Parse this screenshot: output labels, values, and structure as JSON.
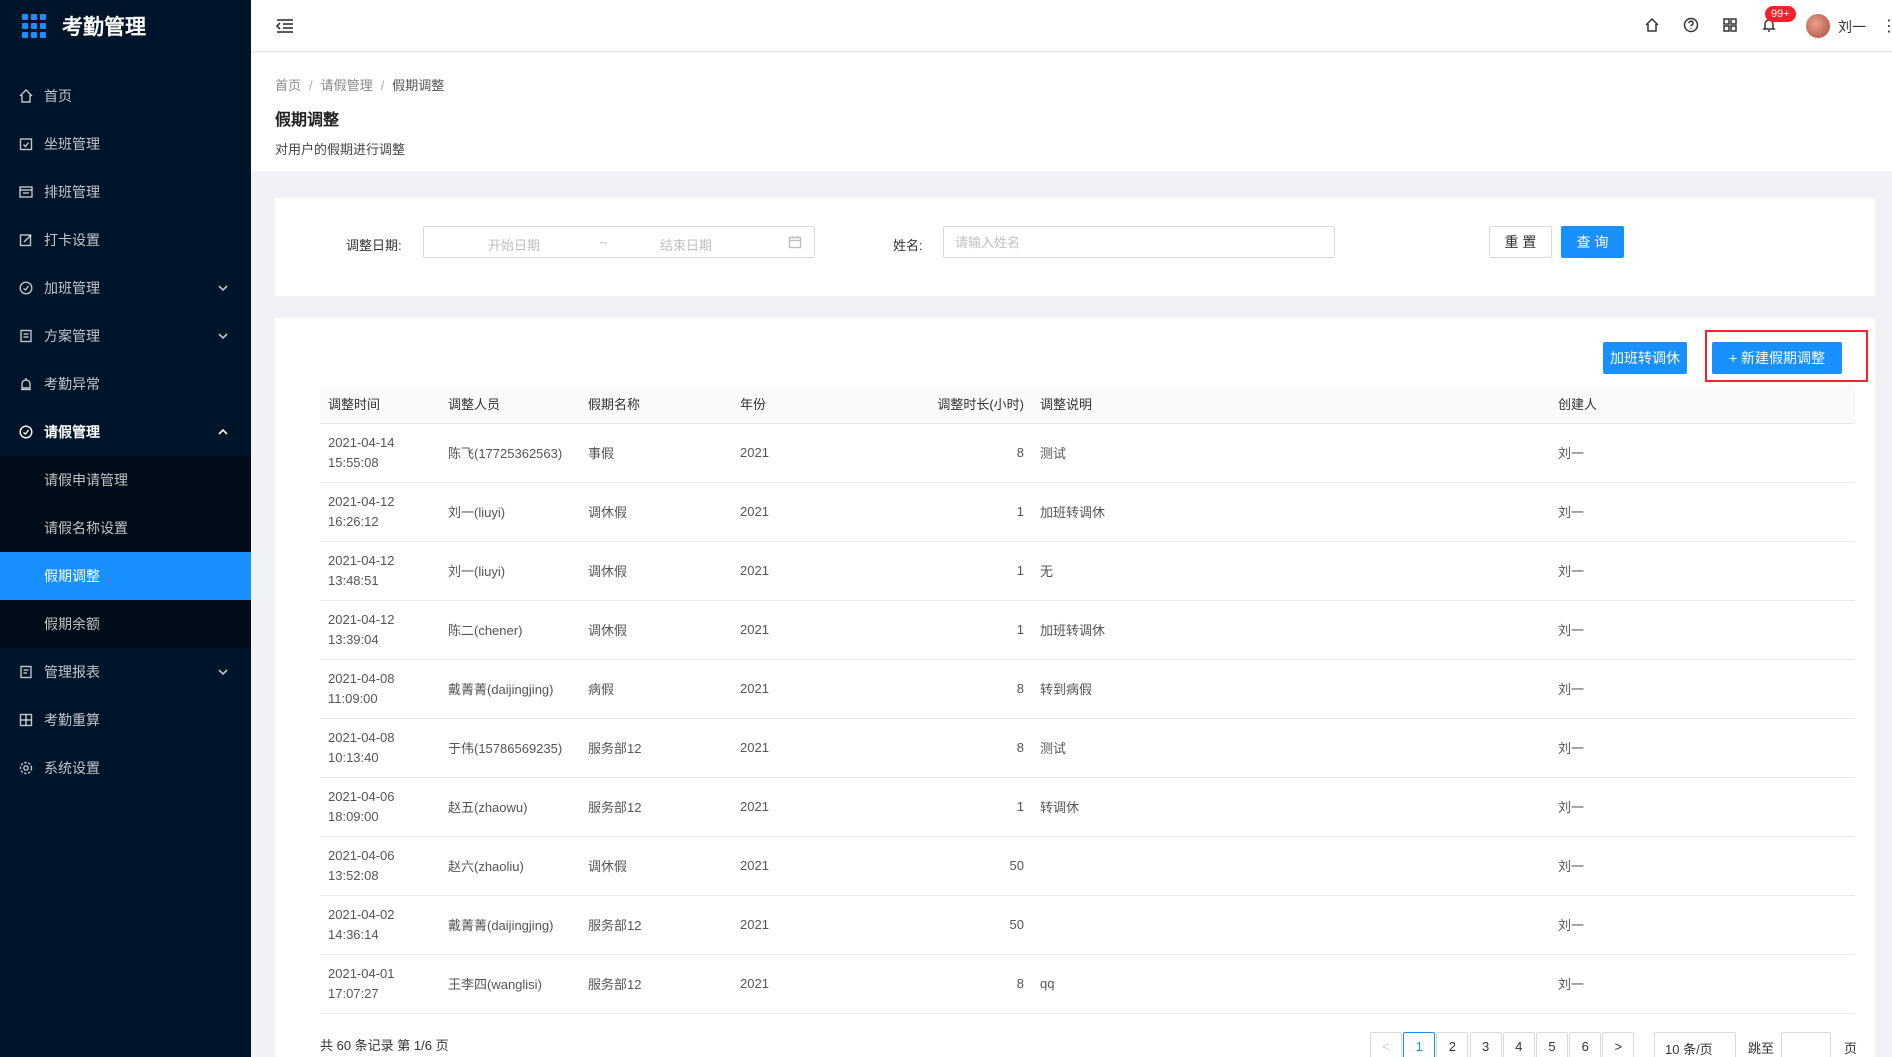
{
  "app": {
    "title": "考勤管理"
  },
  "sidebar": {
    "items": [
      {
        "label": "首页",
        "icon": "home-icon",
        "arrow": ""
      },
      {
        "label": "坐班管理",
        "icon": "calendar-check-icon",
        "arrow": ""
      },
      {
        "label": "排班管理",
        "icon": "schedule-icon",
        "arrow": ""
      },
      {
        "label": "打卡设置",
        "icon": "edit-icon",
        "arrow": ""
      },
      {
        "label": "加班管理",
        "icon": "clock-icon",
        "arrow": "down"
      },
      {
        "label": "方案管理",
        "icon": "file-icon",
        "arrow": "down"
      },
      {
        "label": "考勤异常",
        "icon": "alarm-icon",
        "arrow": ""
      },
      {
        "label": "请假管理",
        "icon": "clock-icon",
        "arrow": "up"
      }
    ],
    "submenu": [
      {
        "label": "请假申请管理"
      },
      {
        "label": "请假名称设置"
      },
      {
        "label": "假期调整"
      },
      {
        "label": "假期余额"
      }
    ],
    "items_after": [
      {
        "label": "管理报表",
        "icon": "report-icon",
        "arrow": "down"
      },
      {
        "label": "考勤重算",
        "icon": "calculator-icon",
        "arrow": ""
      },
      {
        "label": "系统设置",
        "icon": "gear-icon",
        "arrow": ""
      }
    ]
  },
  "header": {
    "badge": "99+",
    "username": "刘一"
  },
  "breadcrumb": [
    "首页",
    "请假管理",
    "假期调整"
  ],
  "page": {
    "title": "假期调整",
    "description": "对用户的假期进行调整"
  },
  "search": {
    "date_label": "调整日期:",
    "start_placeholder": "开始日期",
    "range_sep": "~",
    "end_placeholder": "结束日期",
    "name_label": "姓名:",
    "name_placeholder": "请输入姓名",
    "reset_label": "重 置",
    "query_label": "查 询"
  },
  "actions": {
    "convert_label": "加班转调休",
    "create_label": "+ 新建假期调整"
  },
  "table": {
    "columns": [
      "调整时间",
      "调整人员",
      "假期名称",
      "年份",
      "调整时长(小时)",
      "调整说明",
      "创建人"
    ],
    "rows": [
      {
        "date": "2021-04-14",
        "time": "15:55:08",
        "person": "陈飞(17725362563)",
        "leave": "事假",
        "year": "2021",
        "hours": "8",
        "note": "测试",
        "creator": "刘一"
      },
      {
        "date": "2021-04-12",
        "time": "16:26:12",
        "person": "刘一(liuyi)",
        "leave": "调休假",
        "year": "2021",
        "hours": "1",
        "note": "加班转调休",
        "creator": "刘一"
      },
      {
        "date": "2021-04-12",
        "time": "13:48:51",
        "person": "刘一(liuyi)",
        "leave": "调休假",
        "year": "2021",
        "hours": "1",
        "note": "无",
        "creator": "刘一"
      },
      {
        "date": "2021-04-12",
        "time": "13:39:04",
        "person": "陈二(chener)",
        "leave": "调休假",
        "year": "2021",
        "hours": "1",
        "note": "加班转调休",
        "creator": "刘一"
      },
      {
        "date": "2021-04-08",
        "time": "11:09:00",
        "person": "戴菁菁(daijingjing)",
        "leave": "病假",
        "year": "2021",
        "hours": "8",
        "note": "转到病假",
        "creator": "刘一"
      },
      {
        "date": "2021-04-08",
        "time": "10:13:40",
        "person": "于伟(15786569235)",
        "leave": "服务部12",
        "year": "2021",
        "hours": "8",
        "note": "测试",
        "creator": "刘一"
      },
      {
        "date": "2021-04-06",
        "time": "18:09:00",
        "person": "赵五(zhaowu)",
        "leave": "服务部12",
        "year": "2021",
        "hours": "1",
        "note": "转调休",
        "creator": "刘一"
      },
      {
        "date": "2021-04-06",
        "time": "13:52:08",
        "person": "赵六(zhaoliu)",
        "leave": "调休假",
        "year": "2021",
        "hours": "50",
        "note": "",
        "creator": "刘一"
      },
      {
        "date": "2021-04-02",
        "time": "14:36:14",
        "person": "戴菁菁(daijingjing)",
        "leave": "服务部12",
        "year": "2021",
        "hours": "50",
        "note": "",
        "creator": "刘一"
      },
      {
        "date": "2021-04-01",
        "time": "17:07:27",
        "person": "王李四(wanglisi)",
        "leave": "服务部12",
        "year": "2021",
        "hours": "8",
        "note": "qq",
        "creator": "刘一"
      }
    ]
  },
  "pagination": {
    "total_text": "共 60 条记录 第 1/6 页",
    "prev": "<",
    "next": ">",
    "pages": [
      "1",
      "2",
      "3",
      "4",
      "5",
      "6"
    ],
    "current": "1",
    "page_size": "10 条/页",
    "jump_label": "跳至",
    "page_label": "页"
  },
  "colors": {
    "primary": "#1890ff",
    "sidebar": "#001529",
    "highlight": "#f5222d"
  }
}
